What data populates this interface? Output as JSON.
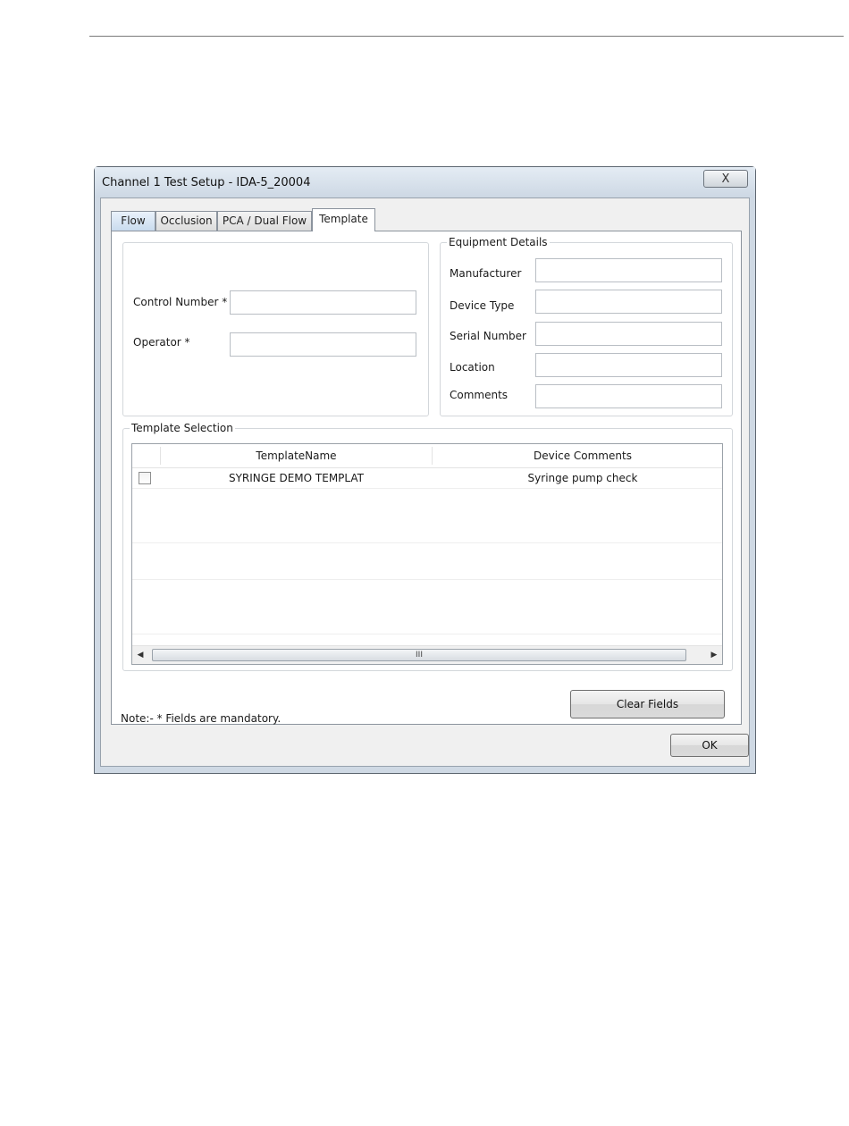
{
  "dialog": {
    "title": "Channel 1 Test Setup - IDA-5_20004",
    "close_glyph": "X"
  },
  "tabs": [
    "Flow",
    "Occlusion",
    "PCA / Dual Flow",
    "Template"
  ],
  "active_tab": "Template",
  "left_group": {
    "control_number_label": "Control Number *",
    "control_number_value": "",
    "operator_label": "Operator *",
    "operator_value": ""
  },
  "equipment": {
    "legend": "Equipment Details",
    "manufacturer_label": "Manufacturer",
    "manufacturer_value": "",
    "device_type_label": "Device Type",
    "device_type_value": "",
    "serial_number_label": "Serial Number",
    "serial_number_value": "",
    "location_label": "Location",
    "location_value": "",
    "comments_label": "Comments",
    "comments_value": ""
  },
  "template_selection": {
    "legend": "Template Selection",
    "columns": [
      "TemplateName",
      "Device Comments"
    ],
    "rows": [
      {
        "checked": false,
        "name": "SYRINGE DEMO TEMPLAT",
        "comments": "Syringe pump check"
      }
    ],
    "scroll_thumb_grip": "III"
  },
  "note": "Note:-   * Fields are mandatory.",
  "buttons": {
    "clear_fields": "Clear Fields",
    "ok": "OK"
  }
}
